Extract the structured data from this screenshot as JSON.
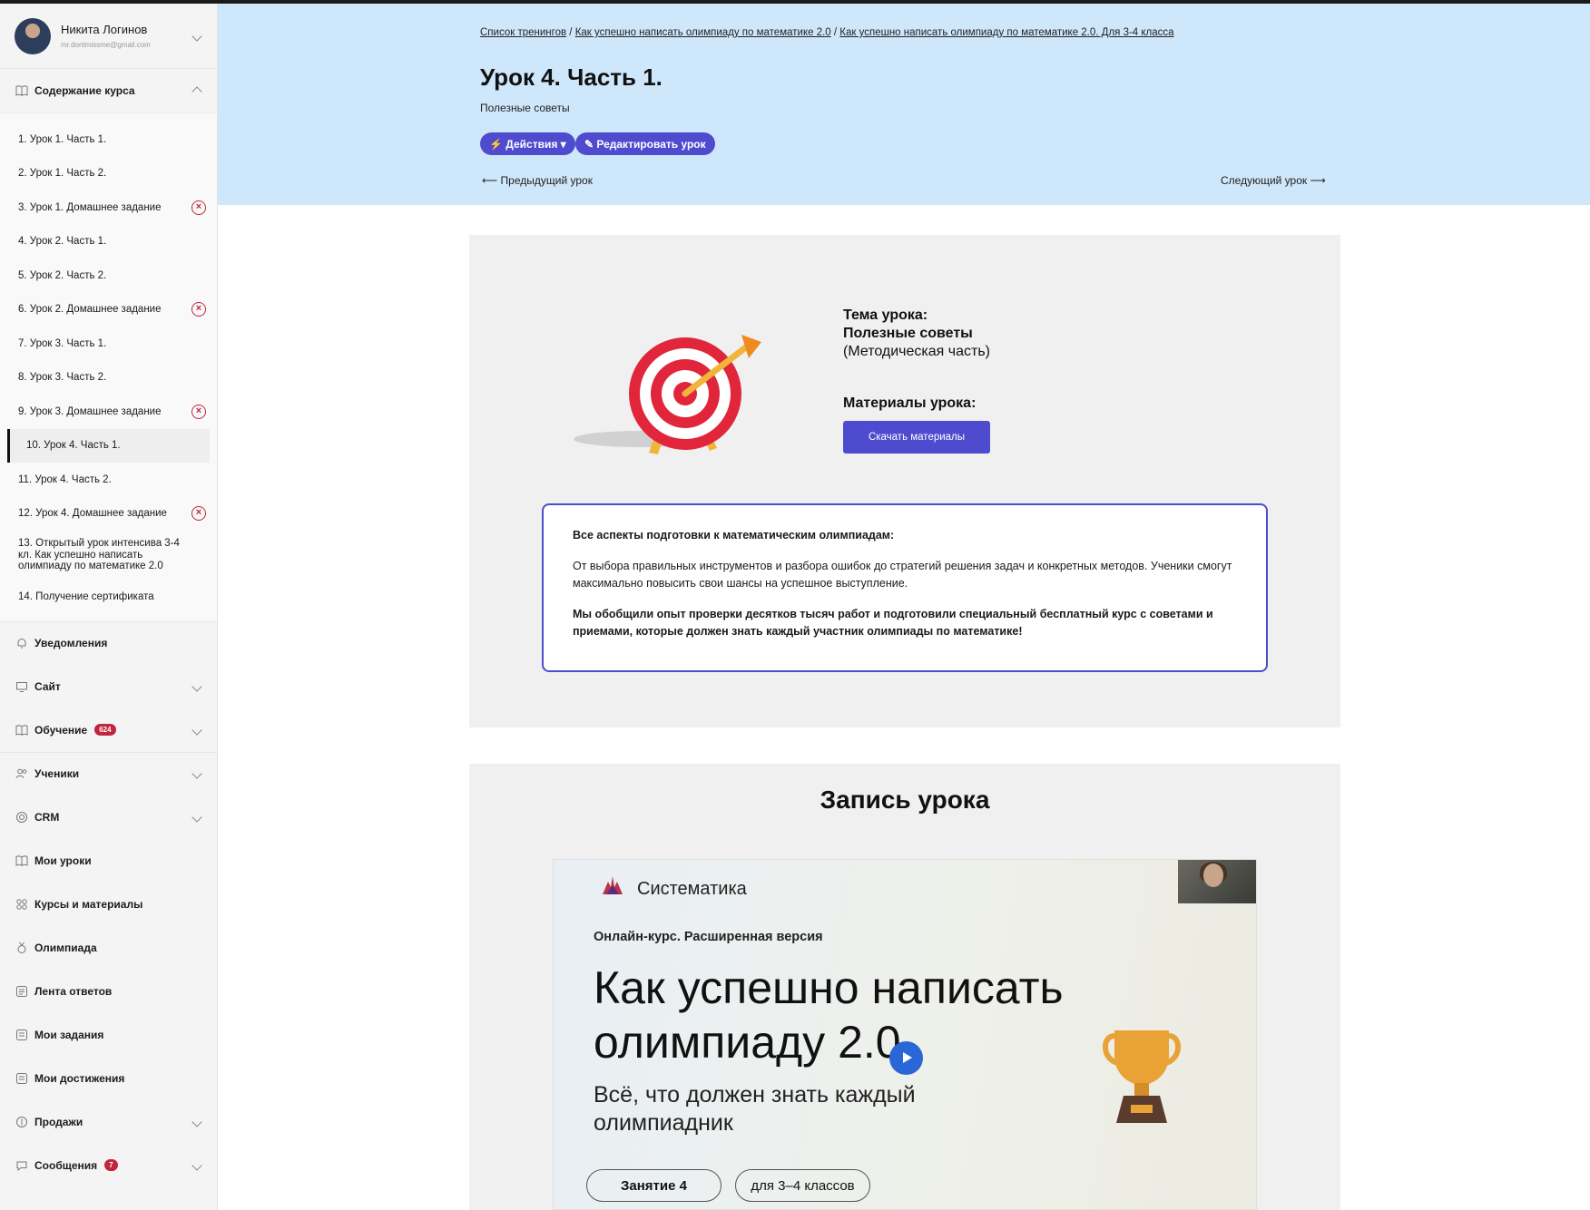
{
  "user": {
    "name": "Никита Логинов",
    "email": "mr.dontmissme@gmail.com"
  },
  "course_section": {
    "title": "Содержание курса",
    "lessons": [
      {
        "label": "1. Урок 1. Часть 1.",
        "failed": false
      },
      {
        "label": "2. Урок 1. Часть 2.",
        "failed": false
      },
      {
        "label": "3. Урок 1. Домашнее задание",
        "failed": true
      },
      {
        "label": "4. Урок 2. Часть 1.",
        "failed": false
      },
      {
        "label": "5. Урок 2. Часть 2.",
        "failed": false
      },
      {
        "label": "6. Урок 2. Домашнее задание",
        "failed": true
      },
      {
        "label": "7. Урок 3. Часть 1.",
        "failed": false
      },
      {
        "label": "8. Урок 3. Часть 2.",
        "failed": false
      },
      {
        "label": "9. Урок 3. Домашнее задание",
        "failed": true
      },
      {
        "label": "10. Урок 4. Часть 1.",
        "failed": false,
        "active": true
      },
      {
        "label": "11. Урок 4. Часть 2.",
        "failed": false
      },
      {
        "label": "12. Урок 4. Домашнее задание",
        "failed": true
      },
      {
        "label": "13. Открытый урок интенсива 3-4 кл. Как успешно написать олимпиаду по математике 2.0",
        "failed": false
      },
      {
        "label": "14. Получение сертификата",
        "failed": false
      }
    ]
  },
  "nav": {
    "notifications": "Уведомления",
    "site": "Сайт",
    "learning": "Обучение",
    "learning_badge": "624",
    "students": "Ученики",
    "crm": "CRM",
    "my_lessons": "Мои уроки",
    "courses": "Курсы и материалы",
    "olympiad": "Олимпиада",
    "answers_feed": "Лента ответов",
    "my_tasks": "Мои задания",
    "achievements": "Мои достижения",
    "sales": "Продажи",
    "messages": "Сообщения",
    "messages_badge": "7"
  },
  "breadcrumb": {
    "item1": "Список тренингов",
    "item2": "Как успешно написать олимпиаду по математике 2.0",
    "item3": "Как успешно написать олимпиаду по математике 2.0. Для 3-4 класса",
    "sep": " / "
  },
  "page": {
    "title": "Урок 4. Часть 1.",
    "subtitle": "Полезные советы",
    "actions_label": "⚡ Действия ▾",
    "edit_label": "✎ Редактировать урок",
    "prev_label": "⟵  Предыдущий урок",
    "next_label": "Следующий урок  ⟶"
  },
  "lesson_info": {
    "topic_label": "Тема урока:",
    "topic_value": "Полезные советы",
    "topic_note": "(Методическая часть)",
    "materials_label": "Материалы урока:",
    "download_label": "Скачать материалы",
    "box_heading": "Все аспекты подготовки к математическим олимпиадам:",
    "box_text": "От выбора правильных инструментов и разбора ошибок до стратегий решения задач и конкретных методов. Ученики смогут максимально повысить свои шансы на успешное выступление.",
    "box_bold": "Мы обобщили опыт проверки десятков тысяч работ и подготовили специальный бесплатный курс с советами и приемами, которые должен знать каждый участник олимпиады по математике!"
  },
  "recording": {
    "title": "Запись урока",
    "video": {
      "brand": "Систематика",
      "course": "Онлайн-курс. Расширенная версия",
      "title_line1": "Как успешно написать",
      "title_line2": "олимпиаду 2.0",
      "sub_line1": "Всё, что должен знать каждый",
      "sub_line2": "олимпиадник",
      "tag1": "Занятие 4",
      "tag2": "для 3–4 классов"
    }
  },
  "colors": {
    "accent": "#4f4bcf",
    "header_bg": "#cfe7fb",
    "error": "#c0263e"
  }
}
